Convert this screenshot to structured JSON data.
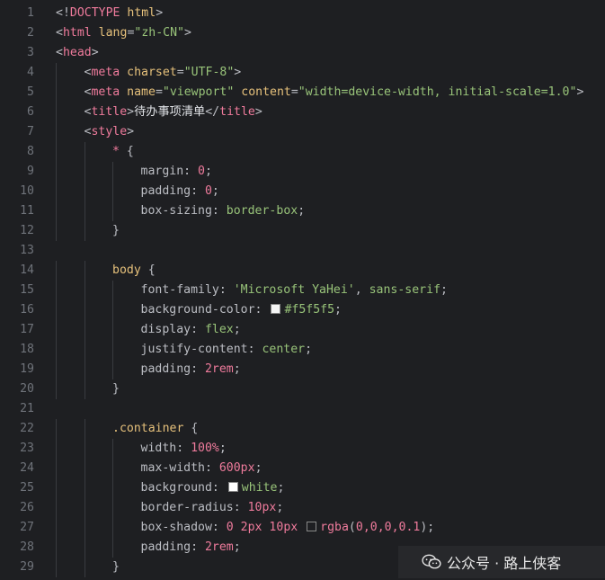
{
  "editor": {
    "lines": [
      {
        "n": "1",
        "indent": 0,
        "tokens": [
          [
            "t-punc",
            "<!"
          ],
          [
            "t-tag",
            "DOCTYPE"
          ],
          [
            "t-punc",
            " "
          ],
          [
            "t-attr",
            "html"
          ],
          [
            "t-punc",
            ">"
          ]
        ]
      },
      {
        "n": "2",
        "indent": 0,
        "tokens": [
          [
            "t-punc",
            "<"
          ],
          [
            "t-tag",
            "html"
          ],
          [
            "t-punc",
            " "
          ],
          [
            "t-attr",
            "lang"
          ],
          [
            "t-punc",
            "="
          ],
          [
            "t-str",
            "\"zh-CN\""
          ],
          [
            "t-punc",
            ">"
          ]
        ]
      },
      {
        "n": "3",
        "indent": 0,
        "tokens": [
          [
            "t-punc",
            "<"
          ],
          [
            "t-tag",
            "head"
          ],
          [
            "t-punc",
            ">"
          ]
        ]
      },
      {
        "n": "4",
        "indent": 1,
        "tokens": [
          [
            "t-punc",
            "<"
          ],
          [
            "t-tag",
            "meta"
          ],
          [
            "t-punc",
            " "
          ],
          [
            "t-attr",
            "charset"
          ],
          [
            "t-punc",
            "="
          ],
          [
            "t-str",
            "\"UTF-8\""
          ],
          [
            "t-punc",
            ">"
          ]
        ]
      },
      {
        "n": "5",
        "indent": 1,
        "tokens": [
          [
            "t-punc",
            "<"
          ],
          [
            "t-tag",
            "meta"
          ],
          [
            "t-punc",
            " "
          ],
          [
            "t-attr",
            "name"
          ],
          [
            "t-punc",
            "="
          ],
          [
            "t-str",
            "\"viewport\""
          ],
          [
            "t-punc",
            " "
          ],
          [
            "t-attr",
            "content"
          ],
          [
            "t-punc",
            "="
          ],
          [
            "t-str",
            "\"width=device-width, initial-scale=1.0\""
          ],
          [
            "t-punc",
            ">"
          ]
        ]
      },
      {
        "n": "6",
        "indent": 1,
        "tokens": [
          [
            "t-punc",
            "<"
          ],
          [
            "t-tag",
            "title"
          ],
          [
            "t-punc",
            ">"
          ],
          [
            "t-text",
            "待办事项清单"
          ],
          [
            "t-punc",
            "</"
          ],
          [
            "t-tag",
            "title"
          ],
          [
            "t-punc",
            ">"
          ]
        ]
      },
      {
        "n": "7",
        "indent": 1,
        "tokens": [
          [
            "t-punc",
            "<"
          ],
          [
            "t-tag",
            "style"
          ],
          [
            "t-punc",
            ">"
          ]
        ]
      },
      {
        "n": "8",
        "indent": 2,
        "tokens": [
          [
            "t-tag",
            "*"
          ],
          [
            "t-punc",
            " {"
          ]
        ]
      },
      {
        "n": "9",
        "indent": 3,
        "tokens": [
          [
            "t-prop",
            "margin"
          ],
          [
            "t-punc",
            ": "
          ],
          [
            "t-num",
            "0"
          ],
          [
            "t-punc",
            ";"
          ]
        ]
      },
      {
        "n": "10",
        "indent": 3,
        "tokens": [
          [
            "t-prop",
            "padding"
          ],
          [
            "t-punc",
            ": "
          ],
          [
            "t-num",
            "0"
          ],
          [
            "t-punc",
            ";"
          ]
        ]
      },
      {
        "n": "11",
        "indent": 3,
        "tokens": [
          [
            "t-prop",
            "box-sizing"
          ],
          [
            "t-punc",
            ": "
          ],
          [
            "t-val",
            "border-box"
          ],
          [
            "t-punc",
            ";"
          ]
        ]
      },
      {
        "n": "12",
        "indent": 2,
        "tokens": [
          [
            "t-punc",
            "}"
          ]
        ]
      },
      {
        "n": "13",
        "indent": 2,
        "tokens": []
      },
      {
        "n": "14",
        "indent": 2,
        "tokens": [
          [
            "t-sel",
            "body"
          ],
          [
            "t-punc",
            " {"
          ]
        ]
      },
      {
        "n": "15",
        "indent": 3,
        "tokens": [
          [
            "t-prop",
            "font-family"
          ],
          [
            "t-punc",
            ": "
          ],
          [
            "t-str",
            "'Microsoft YaHei'"
          ],
          [
            "t-punc",
            ", "
          ],
          [
            "t-val",
            "sans-serif"
          ],
          [
            "t-punc",
            ";"
          ]
        ]
      },
      {
        "n": "16",
        "indent": 3,
        "tokens": [
          [
            "t-prop",
            "background-color"
          ],
          [
            "t-punc",
            ": "
          ],
          [
            "swatch",
            "#f5f5f5"
          ],
          [
            "t-val",
            "#f5f5f5"
          ],
          [
            "t-punc",
            ";"
          ]
        ]
      },
      {
        "n": "17",
        "indent": 3,
        "tokens": [
          [
            "t-prop",
            "display"
          ],
          [
            "t-punc",
            ": "
          ],
          [
            "t-val",
            "flex"
          ],
          [
            "t-punc",
            ";"
          ]
        ]
      },
      {
        "n": "18",
        "indent": 3,
        "tokens": [
          [
            "t-prop",
            "justify-content"
          ],
          [
            "t-punc",
            ": "
          ],
          [
            "t-val",
            "center"
          ],
          [
            "t-punc",
            ";"
          ]
        ]
      },
      {
        "n": "19",
        "indent": 3,
        "tokens": [
          [
            "t-prop",
            "padding"
          ],
          [
            "t-punc",
            ": "
          ],
          [
            "t-num",
            "2rem"
          ],
          [
            "t-punc",
            ";"
          ]
        ]
      },
      {
        "n": "20",
        "indent": 2,
        "tokens": [
          [
            "t-punc",
            "}"
          ]
        ]
      },
      {
        "n": "21",
        "indent": 2,
        "tokens": []
      },
      {
        "n": "22",
        "indent": 2,
        "tokens": [
          [
            "t-sel",
            ".container"
          ],
          [
            "t-punc",
            " {"
          ]
        ]
      },
      {
        "n": "23",
        "indent": 3,
        "tokens": [
          [
            "t-prop",
            "width"
          ],
          [
            "t-punc",
            ": "
          ],
          [
            "t-num",
            "100%"
          ],
          [
            "t-punc",
            ";"
          ]
        ]
      },
      {
        "n": "24",
        "indent": 3,
        "tokens": [
          [
            "t-prop",
            "max-width"
          ],
          [
            "t-punc",
            ": "
          ],
          [
            "t-num",
            "600px"
          ],
          [
            "t-punc",
            ";"
          ]
        ]
      },
      {
        "n": "25",
        "indent": 3,
        "tokens": [
          [
            "t-prop",
            "background"
          ],
          [
            "t-punc",
            ": "
          ],
          [
            "swatch",
            "#ffffff"
          ],
          [
            "t-val",
            "white"
          ],
          [
            "t-punc",
            ";"
          ]
        ]
      },
      {
        "n": "26",
        "indent": 3,
        "tokens": [
          [
            "t-prop",
            "border-radius"
          ],
          [
            "t-punc",
            ": "
          ],
          [
            "t-num",
            "10px"
          ],
          [
            "t-punc",
            ";"
          ]
        ]
      },
      {
        "n": "27",
        "indent": 3,
        "tokens": [
          [
            "t-prop",
            "box-shadow"
          ],
          [
            "t-punc",
            ": "
          ],
          [
            "t-num",
            "0 2px 10px"
          ],
          [
            "t-punc",
            " "
          ],
          [
            "swatch",
            "#1e1f22"
          ],
          [
            "t-tag",
            "rgba"
          ],
          [
            "t-punc",
            "("
          ],
          [
            "t-num",
            "0,0,0,0.1"
          ],
          [
            "t-punc",
            ");"
          ]
        ]
      },
      {
        "n": "28",
        "indent": 3,
        "tokens": [
          [
            "t-prop",
            "padding"
          ],
          [
            "t-punc",
            ": "
          ],
          [
            "t-num",
            "2rem"
          ],
          [
            "t-punc",
            ";"
          ]
        ]
      },
      {
        "n": "29",
        "indent": 2,
        "tokens": [
          [
            "t-punc",
            "}"
          ]
        ]
      }
    ]
  },
  "watermark": {
    "text": "公众号 · 路上侠客",
    "icon": "wechat-icon"
  }
}
